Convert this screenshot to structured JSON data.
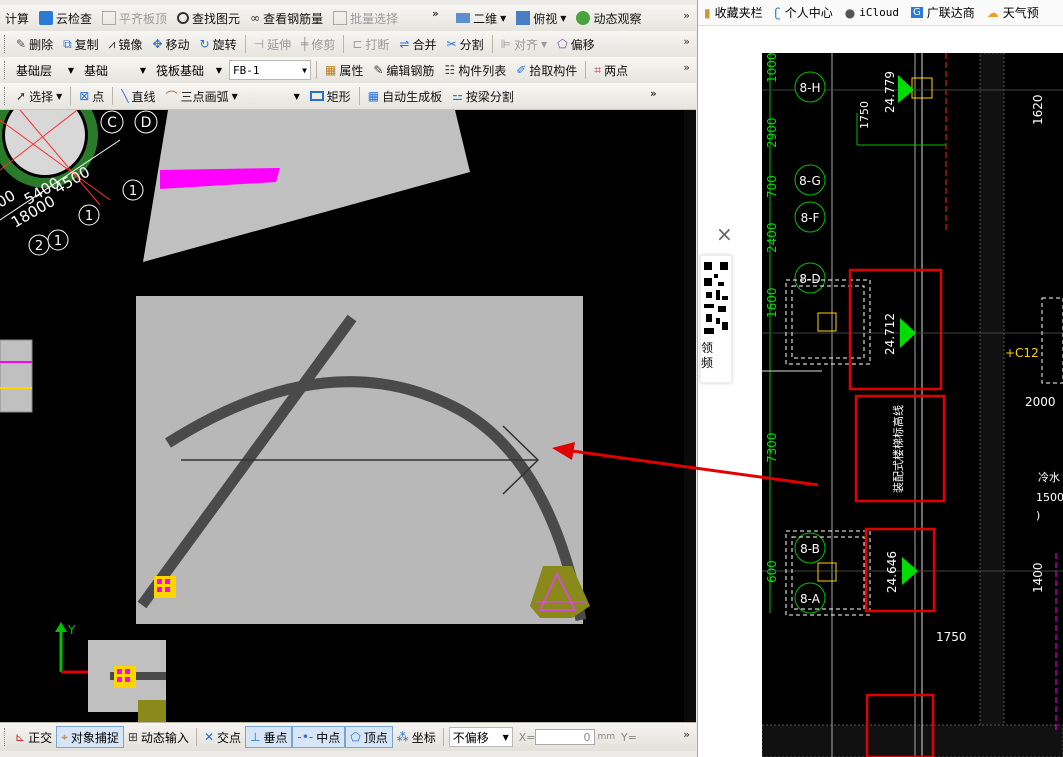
{
  "toolbar1": {
    "calc": "计算",
    "cloud_check": "云检查",
    "align_slab_top": "平齐板顶",
    "find_element": "查找图元",
    "view_rebar_qty": "查看钢筋量",
    "batch_select": "批量选择",
    "view_2d": "二维",
    "view_top": "俯视",
    "dynamic_observe": "动态观察"
  },
  "toolbar2": {
    "delete": "删除",
    "copy": "复制",
    "mirror": "镜像",
    "move": "移动",
    "rotate": "旋转",
    "extend": "延伸",
    "trim": "修剪",
    "break": "打断",
    "merge": "合并",
    "split": "分割",
    "align": "对齐",
    "offset": "偏移"
  },
  "toolbar3": {
    "layer": "基础层",
    "category": "基础",
    "type": "筏板基础",
    "element": "FB-1",
    "properties": "属性",
    "edit_rebar": "编辑钢筋",
    "component_list": "构件列表",
    "pick_component": "拾取构件",
    "two_points": "两点"
  },
  "toolbar4": {
    "select": "选择",
    "point": "点",
    "line": "直线",
    "three_point_arc": "三点画弧",
    "rect": "矩形",
    "auto_generate_slab": "自动生成板",
    "split_by_beam": "按梁分割"
  },
  "canvas": {
    "dims": [
      "4500",
      "5400",
      "18000",
      "00"
    ],
    "axis_labels": [
      "C",
      "D",
      "1",
      "1",
      "2",
      "1"
    ],
    "axis_x": "X",
    "axis_y": "Y"
  },
  "statusbar": {
    "ortho": "正交",
    "snap": "对象捕捉",
    "dynamic_input": "动态输入",
    "intersection": "交点",
    "perpendicular": "垂点",
    "midpoint": "中点",
    "vertex": "顶点",
    "coordinate": "坐标",
    "offset_mode": "不偏移",
    "x_label": "X=",
    "x_value": "0",
    "unit": "mm",
    "y_label": "Y="
  },
  "favorites": {
    "favorites_bar": "收藏夹栏",
    "personal_center": "个人中心",
    "icloud": "iCloud",
    "glodon": "广联达商",
    "weather": "天气预"
  },
  "side_card": {
    "text1": "领",
    "text2": "频"
  },
  "cad_drawing": {
    "dims_left": [
      "1000",
      "2900",
      "700",
      "2400",
      "1600",
      "7300",
      "600"
    ],
    "dims_right": [
      "1620",
      "1400"
    ],
    "dim_bottom": "1750",
    "dim_2000": "2000",
    "axes": [
      "8-H",
      "8-G",
      "8-F",
      "8-D",
      "8-B",
      "8-A"
    ],
    "elevations": [
      "24.779",
      "24.712",
      "24.646"
    ],
    "vertical_note": "装配式楼梯标高线",
    "label_c12": "+C12",
    "label_1750": "1750",
    "note_right1": "冷水",
    "note_right2": "1500"
  },
  "colors": {
    "cad_green": "#00ff00",
    "cad_red": "#ff2020",
    "highlight_red": "#e00000",
    "magenta": "#ff00ff"
  }
}
